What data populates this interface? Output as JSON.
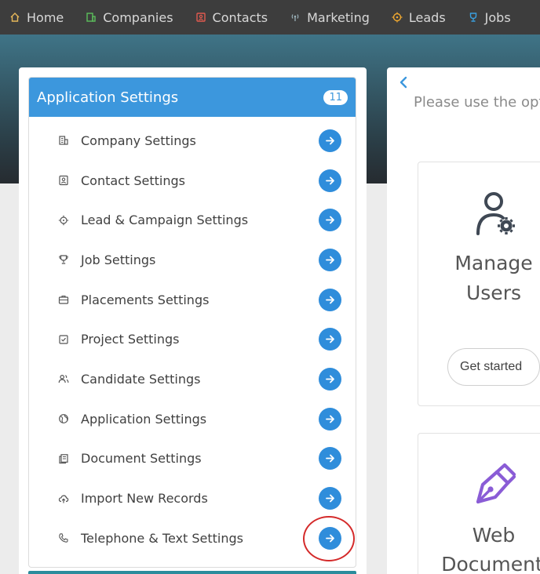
{
  "nav": {
    "items": [
      {
        "label": "Home",
        "icon": "home-icon",
        "color": "#e7b85a"
      },
      {
        "label": "Companies",
        "icon": "building-icon",
        "color": "#5cbf5c"
      },
      {
        "label": "Contacts",
        "icon": "contact-card-icon",
        "color": "#e05a4f"
      },
      {
        "label": "Marketing",
        "icon": "broadcast-icon",
        "color": "#9ab0b8"
      },
      {
        "label": "Leads",
        "icon": "target-icon",
        "color": "#f0a830"
      },
      {
        "label": "Jobs",
        "icon": "trophy-icon",
        "color": "#3aa0e0"
      }
    ]
  },
  "panel": {
    "title": "Application Settings",
    "count": "11",
    "items": [
      {
        "label": "Company Settings",
        "icon": "building-icon"
      },
      {
        "label": "Contact Settings",
        "icon": "contact-card-icon"
      },
      {
        "label": "Lead & Campaign Settings",
        "icon": "crosshair-icon"
      },
      {
        "label": "Job Settings",
        "icon": "trophy-icon"
      },
      {
        "label": "Placements Settings",
        "icon": "briefcase-icon"
      },
      {
        "label": "Project Settings",
        "icon": "checkbox-icon"
      },
      {
        "label": "Candidate Settings",
        "icon": "users-icon"
      },
      {
        "label": "Application Settings",
        "icon": "globe-icon"
      },
      {
        "label": "Document Settings",
        "icon": "documents-icon"
      },
      {
        "label": "Import New Records",
        "icon": "cloud-upload-icon"
      },
      {
        "label": "Telephone & Text Settings",
        "icon": "phone-icon"
      }
    ]
  },
  "main": {
    "intro": "Please use the opt",
    "cards": [
      {
        "title_line1": "Manage",
        "title_line2": "Users",
        "button": "Get started",
        "icon": "user-gear-icon"
      },
      {
        "title_line1": "Web",
        "title_line2": "Document",
        "icon": "pen-nib-icon"
      }
    ]
  },
  "colors": {
    "accent": "#3c97dd",
    "button": "#2f8ddb",
    "highlight": "#d42a2a",
    "nib": "#8a5cd6"
  }
}
